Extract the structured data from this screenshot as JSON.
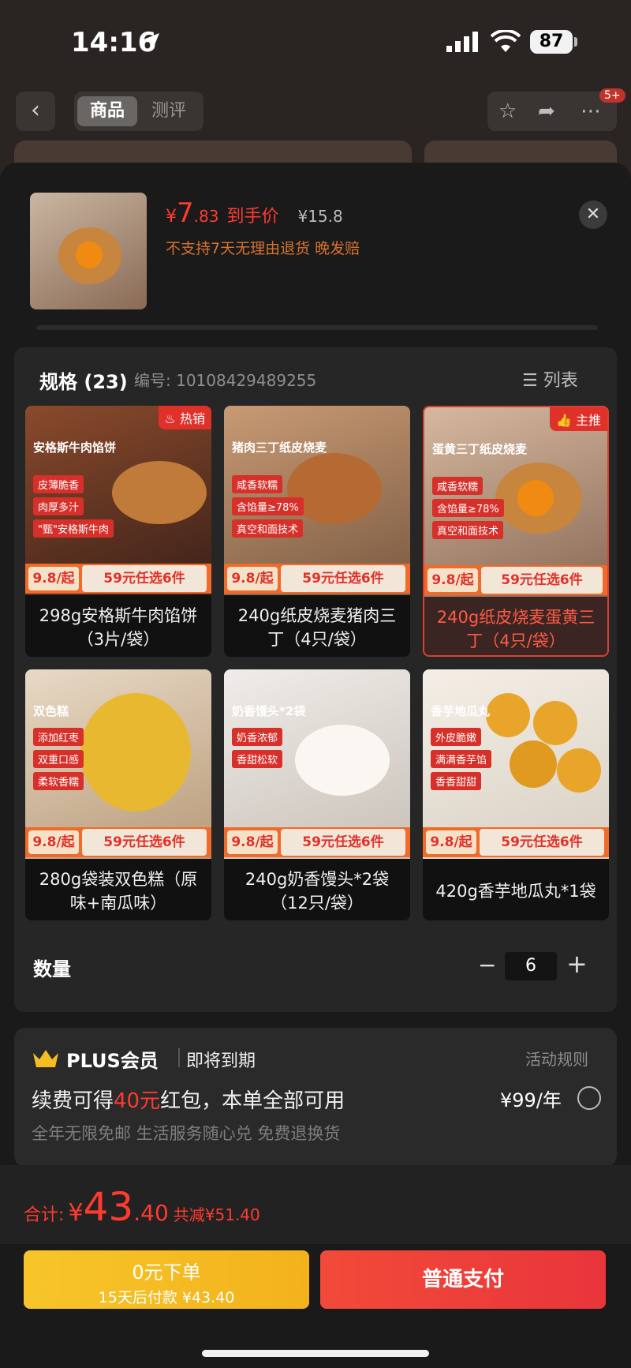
{
  "status_bar": {
    "time": "14:16",
    "battery": "87"
  },
  "header": {
    "tab_goods": "商品",
    "tab_review": "测评",
    "badge": "5+"
  },
  "product": {
    "price_symbol": "¥",
    "price_int": "7",
    "price_dec": ".83",
    "price_label": "到手价",
    "original_price": "¥15.8",
    "policy": "不支持7天无理由退货  晚发赔"
  },
  "spec": {
    "title": "规格 (23)",
    "code": "编号: 10108429489255",
    "list_toggle": "列表",
    "items": [
      {
        "label": "298g安格斯牛肉馅饼（3片/袋）",
        "badge": "热销",
        "img_title": "安格斯牛肉馅饼",
        "chips": [
          "皮薄脆香",
          "肉厚多汁",
          "\"甄\"安格斯牛肉"
        ],
        "strip_left": "9.8/起",
        "strip_right": "59元任选6件"
      },
      {
        "label": "240g纸皮烧麦猪肉三丁（4只/袋）",
        "badge": "",
        "img_title": "猪肉三丁纸皮烧麦",
        "chips": [
          "咸香软糯",
          "含馅量≥78%",
          "真空和面技术"
        ],
        "strip_left": "9.8/起",
        "strip_right": "59元任选6件"
      },
      {
        "label": "240g纸皮烧麦蛋黄三丁（4只/袋）",
        "badge": "主推",
        "img_title": "蛋黄三丁纸皮烧麦",
        "chips": [
          "咸香软糯",
          "含馅量≥78%",
          "真空和面技术"
        ],
        "strip_left": "9.8/起",
        "strip_right": "59元任选6件"
      },
      {
        "label": "280g袋装双色糕（原味+南瓜味）",
        "badge": "",
        "img_title": "双色糕",
        "chips": [
          "添加红枣",
          "双重口感",
          "柔软香糯"
        ],
        "strip_left": "9.8/起",
        "strip_right": "59元任选6件"
      },
      {
        "label": "240g奶香馒头*2袋（12只/袋）",
        "badge": "",
        "img_title": "奶香馒头*2袋",
        "chips": [
          "奶香浓郁",
          "香甜松软"
        ],
        "strip_left": "9.8/起",
        "strip_right": "59元任选6件"
      },
      {
        "label": "420g香芋地瓜丸*1袋",
        "badge": "",
        "img_title": "香芋地瓜丸",
        "chips": [
          "外皮脆嫩",
          "满满香芋馅",
          "香香甜甜"
        ],
        "strip_left": "9.8/起",
        "strip_right": "59元任选6件"
      }
    ]
  },
  "quantity": {
    "label": "数量",
    "value": "6",
    "minus": "−",
    "plus": "+"
  },
  "plus": {
    "title": "PLUS会员",
    "expire": "即将到期",
    "rules": "活动规则",
    "renew_a": "续费可得",
    "renew_amount": "40元",
    "renew_b": "红包，本单全部可用",
    "yearly": "¥99/年",
    "benefits": "全年无限免邮 生活服务随心兑 免费退换货"
  },
  "total": {
    "label": "合计:",
    "currency": "¥",
    "int": "43",
    "dec": ".40",
    "saved": "共减¥51.40"
  },
  "actions": {
    "zero_line1": "0元下单",
    "zero_line2": "15天后付款 ¥43.40",
    "pay": "普通支付"
  },
  "colors": {
    "accent_red": "#ff3b30",
    "orange": "#d6722e",
    "gold": "#f5bd24"
  }
}
